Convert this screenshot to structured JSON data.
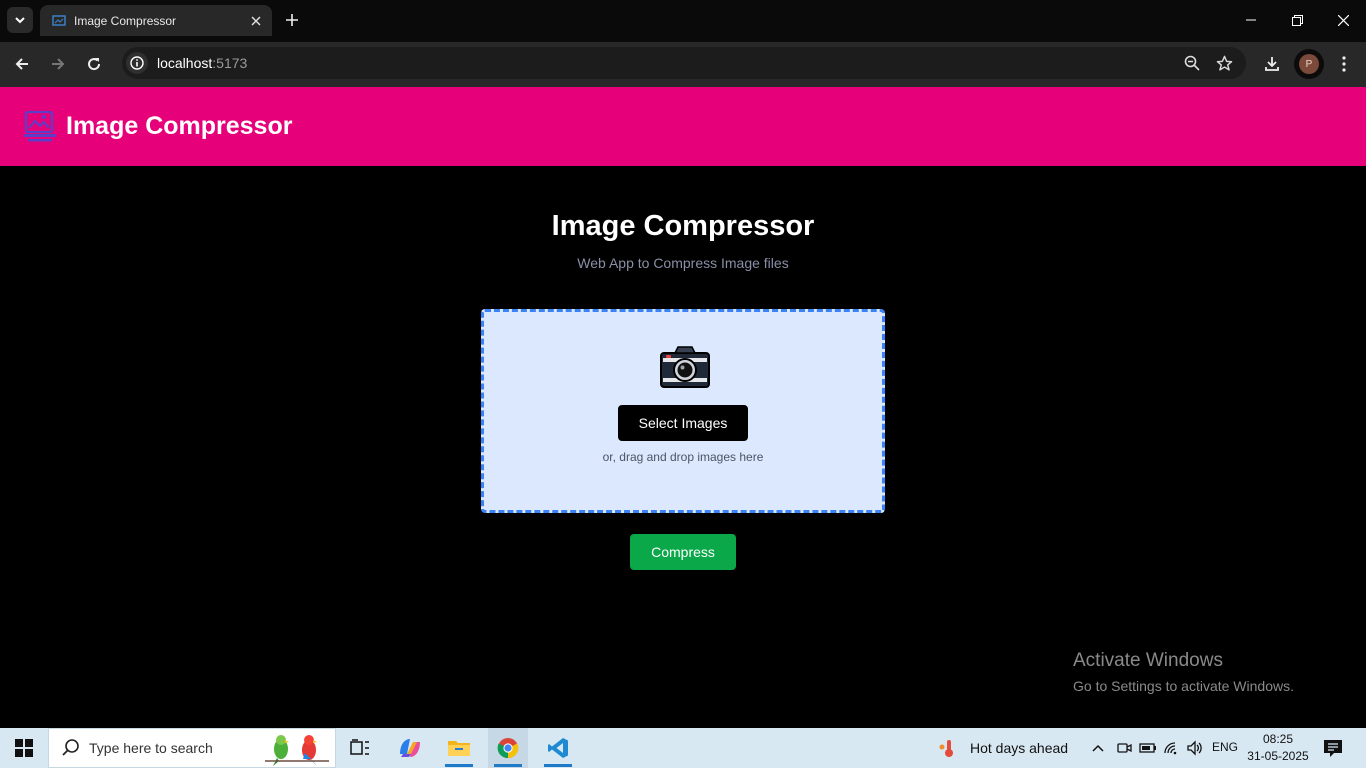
{
  "browser": {
    "tab_title": "Image Compressor",
    "url_host": "localhost",
    "url_port": ":5173",
    "profile_initial": "P"
  },
  "app": {
    "header_title": "Image Compressor",
    "page_title": "Image Compressor",
    "subtitle": "Web App to Compress Image files",
    "select_button": "Select Images",
    "drop_hint": "or, drag and drop images here",
    "compress_button": "Compress",
    "accent_color": "#e6007a",
    "compress_color": "#0aa848"
  },
  "watermark": {
    "title": "Activate Windows",
    "subtitle": "Go to Settings to activate Windows."
  },
  "taskbar": {
    "search_placeholder": "Type here to search",
    "weather": "Hot days ahead",
    "language": "ENG",
    "time": "08:25",
    "date": "31-05-2025"
  }
}
